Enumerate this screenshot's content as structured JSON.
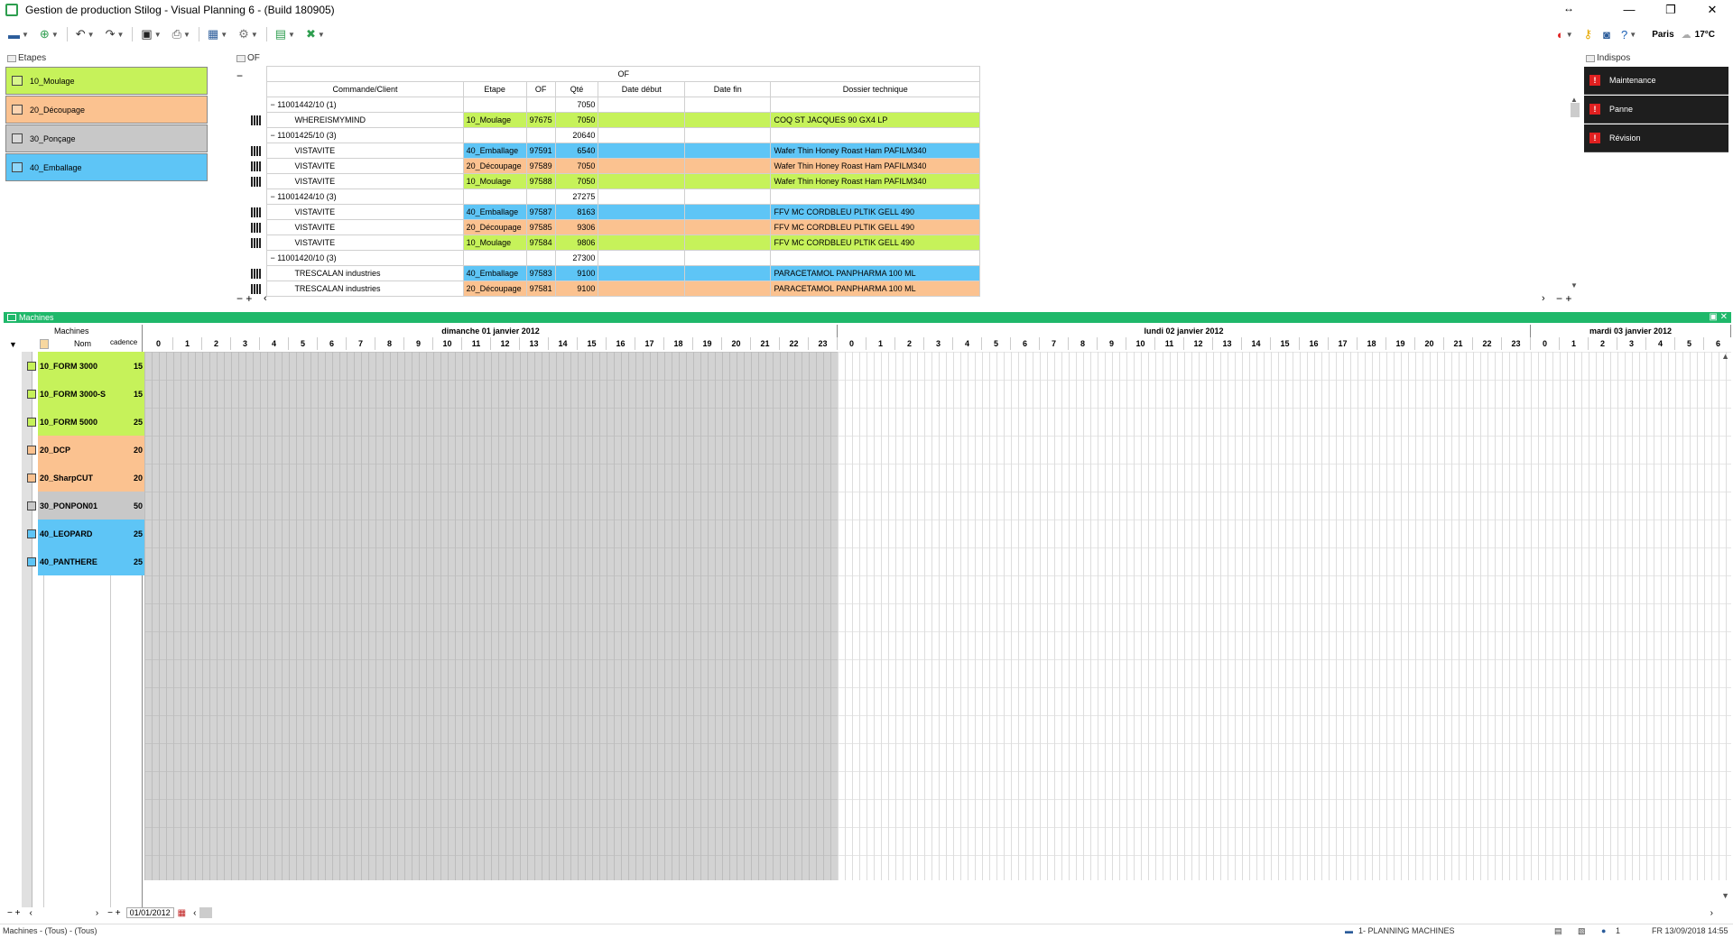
{
  "window": {
    "title": "Gestion de production Stilog - Visual Planning 6 - (Build 180905)",
    "controls": [
      "↔",
      "—",
      "❐",
      "✕"
    ]
  },
  "toolbar": {
    "city": "Paris",
    "temperature": "17°C"
  },
  "etapes": {
    "title": "Etapes",
    "items": [
      {
        "label": "10_Moulage",
        "color": "#c6f25a"
      },
      {
        "label": "20_Découpage",
        "color": "#fbc290"
      },
      {
        "label": "30_Ponçage",
        "color": "#c8c8c8"
      },
      {
        "label": "40_Emballage",
        "color": "#5ec5f6"
      }
    ]
  },
  "of": {
    "panel_title": "OF",
    "grid_title": "OF",
    "columns": [
      "Commande/Client",
      "Etape",
      "OF",
      "Qté",
      "Date début",
      "Date fin",
      "Dossier technique"
    ],
    "rows": [
      {
        "type": "group",
        "label": "11001442/10 (1)",
        "qty": "7050"
      },
      {
        "type": "item",
        "client": "WHEREISMYMIND",
        "etape": "10_Moulage",
        "of": "97675",
        "qty": "7050",
        "dossier": "COQ ST JACQUES 90 GX4 LP",
        "color": "moul"
      },
      {
        "type": "group",
        "label": "11001425/10 (3)",
        "qty": "20640"
      },
      {
        "type": "item",
        "client": "VISTAVITE",
        "etape": "40_Emballage",
        "of": "97591",
        "qty": "6540",
        "dossier": "Wafer Thin Honey Roast Ham PAFILM340",
        "color": "emb"
      },
      {
        "type": "item",
        "client": "VISTAVITE",
        "etape": "20_Découpage",
        "of": "97589",
        "qty": "7050",
        "dossier": "Wafer Thin Honey Roast Ham PAFILM340",
        "color": "dec"
      },
      {
        "type": "item",
        "client": "VISTAVITE",
        "etape": "10_Moulage",
        "of": "97588",
        "qty": "7050",
        "dossier": "Wafer Thin Honey Roast Ham PAFILM340",
        "color": "moul"
      },
      {
        "type": "group",
        "label": "11001424/10 (3)",
        "qty": "27275"
      },
      {
        "type": "item",
        "client": "VISTAVITE",
        "etape": "40_Emballage",
        "of": "97587",
        "qty": "8163",
        "dossier": "FFV MC CORDBLEU PLTIK GELL 490",
        "color": "emb"
      },
      {
        "type": "item",
        "client": "VISTAVITE",
        "etape": "20_Découpage",
        "of": "97585",
        "qty": "9306",
        "dossier": "FFV MC CORDBLEU PLTIK GELL 490",
        "color": "dec"
      },
      {
        "type": "item",
        "client": "VISTAVITE",
        "etape": "10_Moulage",
        "of": "97584",
        "qty": "9806",
        "dossier": "FFV MC CORDBLEU PLTIK GELL 490",
        "color": "moul"
      },
      {
        "type": "group",
        "label": "11001420/10 (3)",
        "qty": "27300"
      },
      {
        "type": "item",
        "client": "TRESCALAN industries",
        "etape": "40_Emballage",
        "of": "97583",
        "qty": "9100",
        "dossier": "PARACETAMOL PANPHARMA 100 ML",
        "color": "emb"
      },
      {
        "type": "item",
        "client": "TRESCALAN industries",
        "etape": "20_Découpage",
        "of": "97581",
        "qty": "9100",
        "dossier": "PARACETAMOL PANPHARMA 100 ML",
        "color": "dec"
      }
    ]
  },
  "indispos": {
    "title": "Indispos",
    "items": [
      "Maintenance",
      "Panne",
      "Révision"
    ]
  },
  "machines": {
    "title": "Machines",
    "col_group": "Machines",
    "col_name": "Nom",
    "col_cadence": "cadence",
    "rows": [
      {
        "name": "10_FORM 3000",
        "cadence": "15",
        "color": "#c6f25a"
      },
      {
        "name": "10_FORM 3000-S",
        "cadence": "15",
        "color": "#c6f25a"
      },
      {
        "name": "10_FORM 5000",
        "cadence": "25",
        "color": "#c6f25a"
      },
      {
        "name": "20_DCP",
        "cadence": "20",
        "color": "#fbc290"
      },
      {
        "name": "20_SharpCUT",
        "cadence": "20",
        "color": "#fbc290"
      },
      {
        "name": "30_PONPON01",
        "cadence": "50",
        "color": "#c8c8c8"
      },
      {
        "name": "40_LEOPARD",
        "cadence": "25",
        "color": "#5ec5f6"
      },
      {
        "name": "40_PANTHERE",
        "cadence": "25",
        "color": "#5ec5f6"
      }
    ],
    "days": [
      "dimanche 01 janvier 2012",
      "lundi 02 janvier 2012",
      "mardi 03 janvier 2012"
    ],
    "date_field": "01/01/2012"
  },
  "status": {
    "left": "Machines - (Tous) - (Tous)",
    "view": "1- PLANNING MACHINES",
    "users": "1",
    "datetime": "FR 13/09/2018 14:55"
  }
}
